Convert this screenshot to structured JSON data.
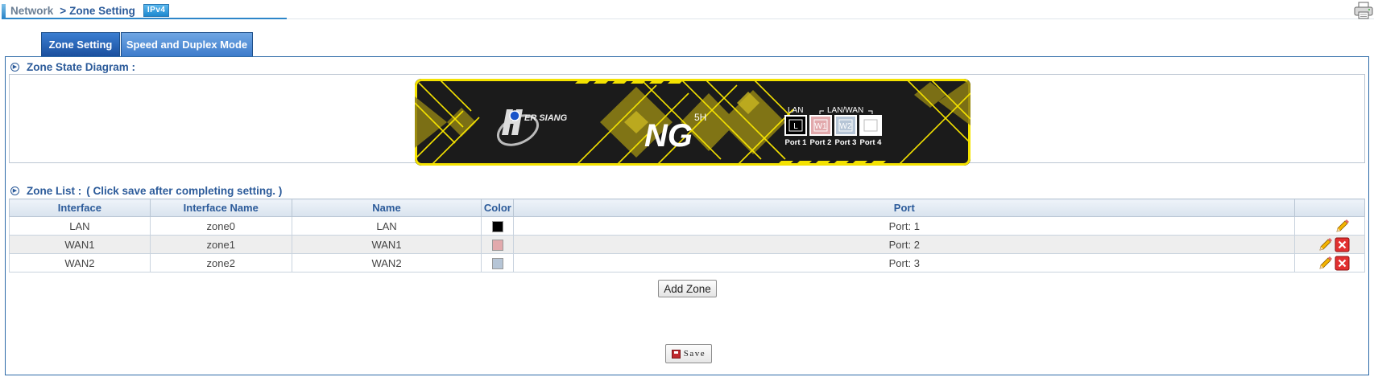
{
  "breadcrumb": {
    "root": "Network",
    "separator": ">",
    "current": "Zone Setting",
    "badge": "IPv4"
  },
  "tabs": [
    {
      "label": "Zone Setting",
      "active": true
    },
    {
      "label": "Speed and Duplex Mode",
      "active": false
    }
  ],
  "diagram": {
    "title": "Zone State Diagram :",
    "brand": {
      "logo_text": "ER SIANG",
      "model": "NG",
      "model_sup": "5H"
    },
    "group_labels": {
      "lan": "LAN",
      "lanwan": "LAN/WAN"
    },
    "ports": [
      {
        "tag": "L",
        "label": "Port 1",
        "color": "#000000"
      },
      {
        "tag": "W1",
        "label": "Port 2",
        "color": "#e2a9ac"
      },
      {
        "tag": "W2",
        "label": "Port 3",
        "color": "#b6c5d6"
      },
      {
        "tag": "",
        "label": "Port 4",
        "color": "#ffffff"
      }
    ]
  },
  "zone_list": {
    "title": "Zone List :",
    "hint": "( Click save after completing setting. )",
    "columns": [
      "Interface",
      "Interface Name",
      "Name",
      "Color",
      "Port",
      ""
    ],
    "rows": [
      {
        "interface": "LAN",
        "interface_name": "zone0",
        "name": "LAN",
        "color": "#000000",
        "port": "Port: 1",
        "deletable": false
      },
      {
        "interface": "WAN1",
        "interface_name": "zone1",
        "name": "WAN1",
        "color": "#e2a9ac",
        "port": "Port: 2",
        "deletable": true
      },
      {
        "interface": "WAN2",
        "interface_name": "zone2",
        "name": "WAN2",
        "color": "#b6c5d6",
        "port": "Port: 3",
        "deletable": true
      }
    ]
  },
  "buttons": {
    "add_zone": "Add Zone",
    "save": "Save"
  },
  "colors": {
    "accent": "#2c5b9a",
    "tab_active": "#1a4f9e",
    "device_yellow": "#f4e200",
    "device_dark": "#1b1b1b"
  }
}
